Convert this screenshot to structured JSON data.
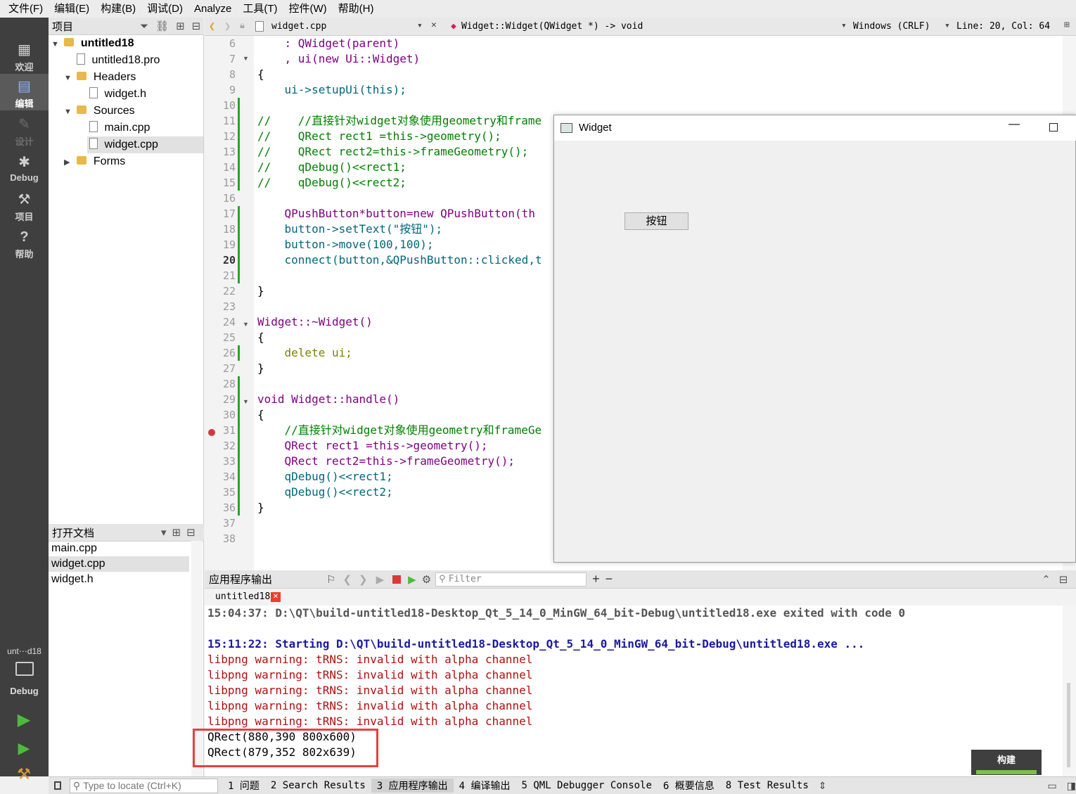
{
  "menu": [
    "文件(F)",
    "编辑(E)",
    "构建(B)",
    "调试(D)",
    "Analyze",
    "工具(T)",
    "控件(W)",
    "帮助(H)"
  ],
  "modes": [
    {
      "label": "欢迎",
      "icon": "grid-icon"
    },
    {
      "label": "编辑",
      "icon": "edit-icon"
    },
    {
      "label": "设计",
      "icon": "pencil-icon"
    },
    {
      "label": "Debug",
      "icon": "bug-icon"
    },
    {
      "label": "项目",
      "icon": "wrench-icon"
    },
    {
      "label": "帮助",
      "icon": "help-icon"
    }
  ],
  "kit": {
    "name": "unt⋯d18",
    "mode": "Debug"
  },
  "project_panel": {
    "title": "项目",
    "tree": [
      {
        "label": "untitled18",
        "type": "project",
        "expanded": true
      },
      {
        "label": "untitled18.pro",
        "type": "file"
      },
      {
        "label": "Headers",
        "type": "folder",
        "expanded": true
      },
      {
        "label": "widget.h",
        "type": "file"
      },
      {
        "label": "Sources",
        "type": "folder",
        "expanded": true
      },
      {
        "label": "main.cpp",
        "type": "file"
      },
      {
        "label": "widget.cpp",
        "type": "file",
        "selected": true
      },
      {
        "label": "Forms",
        "type": "folder",
        "expanded": false
      }
    ]
  },
  "open_docs": {
    "title": "打开文档",
    "items": [
      "main.cpp",
      "widget.cpp",
      "widget.h"
    ],
    "selected": "widget.cpp"
  },
  "editor_toolbar": {
    "file": "widget.cpp",
    "symbol": "Widget::Widget(QWidget *) -> void",
    "line_ending": "Windows (CRLF)",
    "position": "Line: 20, Col: 64"
  },
  "editor": {
    "current_line": 20,
    "lines": [
      {
        "n": "6",
        "t": "    : QWidget(parent)"
      },
      {
        "n": "7",
        "t": "    , ui(new Ui::Widget)"
      },
      {
        "n": "8",
        "t": "{"
      },
      {
        "n": "9",
        "t": "    ui->setupUi(this);"
      },
      {
        "n": "10",
        "t": ""
      },
      {
        "n": "11",
        "t": "//    //直接针对widget对象使用geometry和frame"
      },
      {
        "n": "12",
        "t": "//    QRect rect1 =this->geometry();"
      },
      {
        "n": "13",
        "t": "//    QRect rect2=this->frameGeometry();"
      },
      {
        "n": "14",
        "t": "//    qDebug()<<rect1;"
      },
      {
        "n": "15",
        "t": "//    qDebug()<<rect2;"
      },
      {
        "n": "16",
        "t": ""
      },
      {
        "n": "17",
        "t": "    QPushButton*button=new QPushButton(th"
      },
      {
        "n": "18",
        "t": "    button->setText(\"按钮\");"
      },
      {
        "n": "19",
        "t": "    button->move(100,100);"
      },
      {
        "n": "20",
        "t": "    connect(button,&QPushButton::clicked,t"
      },
      {
        "n": "21",
        "t": ""
      },
      {
        "n": "22",
        "t": "}"
      },
      {
        "n": "23",
        "t": ""
      },
      {
        "n": "24",
        "t": "Widget::~Widget()"
      },
      {
        "n": "25",
        "t": "{"
      },
      {
        "n": "26",
        "t": "    delete ui;"
      },
      {
        "n": "27",
        "t": "}"
      },
      {
        "n": "28",
        "t": ""
      },
      {
        "n": "29",
        "t": "void Widget::handle()"
      },
      {
        "n": "30",
        "t": "{"
      },
      {
        "n": "31",
        "t": "    //直接针对widget对象使用geometry和frameGe"
      },
      {
        "n": "32",
        "t": "    QRect rect1 =this->geometry();"
      },
      {
        "n": "33",
        "t": "    QRect rect2=this->frameGeometry();"
      },
      {
        "n": "34",
        "t": "    qDebug()<<rect1;"
      },
      {
        "n": "35",
        "t": "    qDebug()<<rect2;"
      },
      {
        "n": "36",
        "t": "}"
      },
      {
        "n": "37",
        "t": ""
      },
      {
        "n": "38",
        "t": ""
      }
    ]
  },
  "widget_window": {
    "title": "Widget",
    "button_label": "按钮"
  },
  "output": {
    "title": "应用程序输出",
    "filter_placeholder": "Filter",
    "tab": "untitled18",
    "lines": [
      {
        "text": "15:04:37: D:\\QT\\build-untitled18-Desktop_Qt_5_14_0_MinGW_64_bit-Debug\\untitled18.exe exited with code 0",
        "style": "gray"
      },
      {
        "text": "",
        "style": "black"
      },
      {
        "text": "15:11:22: Starting D:\\QT\\build-untitled18-Desktop_Qt_5_14_0_MinGW_64_bit-Debug\\untitled18.exe ...",
        "style": "blue"
      },
      {
        "text": "libpng warning: tRNS: invalid with alpha channel",
        "style": "red"
      },
      {
        "text": "libpng warning: tRNS: invalid with alpha channel",
        "style": "red"
      },
      {
        "text": "libpng warning: tRNS: invalid with alpha channel",
        "style": "red"
      },
      {
        "text": "libpng warning: tRNS: invalid with alpha channel",
        "style": "red"
      },
      {
        "text": "libpng warning: tRNS: invalid with alpha channel",
        "style": "red"
      },
      {
        "text": "QRect(880,390 800x600)",
        "style": "black"
      },
      {
        "text": "QRect(879,352 802x639)",
        "style": "black"
      }
    ]
  },
  "build_badge": "构建",
  "status_bar": {
    "locate_placeholder": "Type to locate (Ctrl+K)",
    "tabs": [
      "1 问题",
      "2 Search Results",
      "3 应用程序输出",
      "4 编译输出",
      "5 QML Debugger Console",
      "6 概要信息",
      "8 Test Results"
    ],
    "active_tab": "3 应用程序输出"
  },
  "colors": {
    "mode_bar": "#3f3f3f",
    "highlight_box": "#e8403c",
    "build_progress": "#7cbf4a"
  }
}
